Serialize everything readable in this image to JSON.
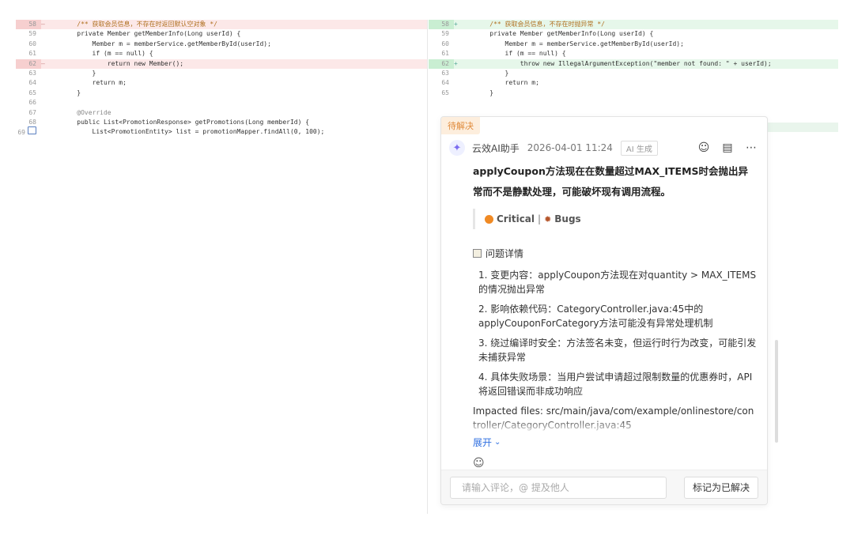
{
  "left_diff": {
    "lines": [
      {
        "n": "58",
        "m": "—",
        "type": "del",
        "code": "    /** 获取会员信息，不存在时返回默认空对象 */"
      },
      {
        "n": "59",
        "m": "",
        "type": "ctx",
        "code": "    private Member getMemberInfo(Long userId) {"
      },
      {
        "n": "60",
        "m": "",
        "type": "ctx",
        "code": "        Member m = memberService.getMemberById(userId);"
      },
      {
        "n": "61",
        "m": "",
        "type": "ctx",
        "code": "        if (m == null) {"
      },
      {
        "n": "62",
        "m": "—",
        "type": "del",
        "code": "            return new Member();"
      },
      {
        "n": "63",
        "m": "",
        "type": "ctx",
        "code": "        }"
      },
      {
        "n": "64",
        "m": "",
        "type": "ctx",
        "code": "        return m;"
      },
      {
        "n": "65",
        "m": "",
        "type": "ctx",
        "code": "    }"
      },
      {
        "n": "66",
        "m": "",
        "type": "ctx",
        "code": ""
      },
      {
        "n": "67",
        "m": "",
        "type": "ctx",
        "code": "    @Override"
      },
      {
        "n": "68",
        "m": "",
        "type": "ctx",
        "code": "    public List<PromotionResponse> getPromotions(Long memberId) {"
      },
      {
        "n": "69",
        "m": "",
        "type": "ctx",
        "code": "        List<PromotionEntity> list = promotionMapper.findAll(0, 100);"
      }
    ]
  },
  "right_diff": {
    "lines": [
      {
        "n": "58",
        "m": "+",
        "type": "add",
        "code": "    /** 获取会员信息，不存在时抛异常 */"
      },
      {
        "n": "59",
        "m": "",
        "type": "ctx",
        "code": "    private Member getMemberInfo(Long userId) {"
      },
      {
        "n": "60",
        "m": "",
        "type": "ctx",
        "code": "        Member m = memberService.getMemberById(userId);"
      },
      {
        "n": "61",
        "m": "",
        "type": "ctx",
        "code": "        if (m == null) {"
      },
      {
        "n": "62",
        "m": "+",
        "type": "add",
        "code": "            throw new IllegalArgumentException(\"member not found: \" + userId);"
      },
      {
        "n": "63",
        "m": "",
        "type": "ctx",
        "code": "        }"
      },
      {
        "n": "64",
        "m": "",
        "type": "ctx",
        "code": "        return m;"
      },
      {
        "n": "65",
        "m": "",
        "type": "ctx",
        "code": "    }"
      }
    ]
  },
  "comment": {
    "status": "待解决",
    "author": "云效AI助手",
    "time": "2026-04-01 11:24",
    "badge": "AI 生成",
    "summary": "applyCoupon方法现在在数量超过MAX_ITEMS时会抛出异常而不是静默处理，可能破坏现有调用流程。",
    "severity": "Critical",
    "category": "Bugs",
    "details_title": "问题详情",
    "items": [
      "1. 变更内容：applyCoupon方法现在对quantity > MAX_ITEMS的情况抛出异常",
      "2. 影响依赖代码：CategoryController.java:45中的applyCouponForCategory方法可能没有异常处理机制",
      "3. 绕过编译时安全：方法签名未变，但运行时行为改变，可能引发未捕获异常",
      "4. 具体失败场景：当用户尝试申请超过限制数量的优惠券时，API将返回错误而非成功响应"
    ],
    "impacted": "Impacted files: src/main/java/com/example/onlinestore/controller/CategoryController.java:45",
    "expand_label": "展开",
    "input_placeholder": "请输入评论，@ 提及他人",
    "resolve_label": "标记为已解决"
  },
  "colors": {
    "deleted_bg": "#fce8e8",
    "added_bg": "#e6f7ea",
    "status_orange": "#e08a3a",
    "link_blue": "#2f6fe0"
  },
  "icons": {
    "avatar": "sparkle-icon",
    "actions": [
      "emoji-icon",
      "comment-icon",
      "more-icon"
    ],
    "severity": "orange-dot-icon",
    "category": "bug-icon",
    "details": "memo-icon",
    "expand": "chevron-down-icon",
    "reaction": "emoji-icon"
  }
}
